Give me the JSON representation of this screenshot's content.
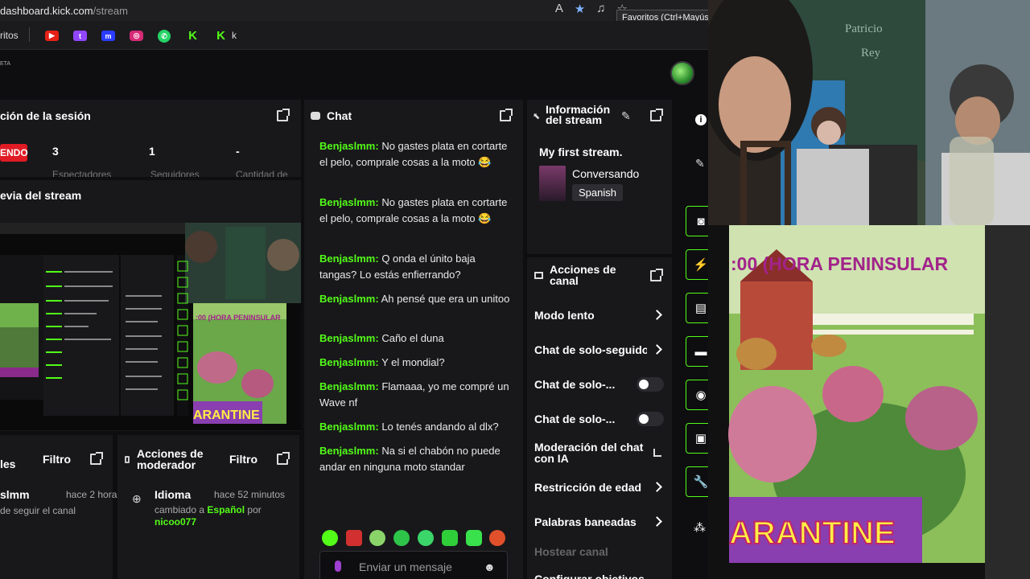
{
  "browser": {
    "url_host": "dashboard.kick.com",
    "url_path": "/stream",
    "tooltip": "Favoritos (Ctrl+Mayús",
    "bookmarks_folder": "ritos",
    "bookmark_last": "k"
  },
  "session": {
    "title": "ción de la sesión",
    "live_label": "ENDO",
    "stats": [
      {
        "value": "3",
        "label": "Espectadores"
      },
      {
        "value": "1",
        "label": "Seguidores"
      },
      {
        "value": "-",
        "label": "Cantidad de"
      }
    ]
  },
  "preview": {
    "title": "evia del stream"
  },
  "chat": {
    "title": "Chat",
    "messages": [
      {
        "user": "Benjaslmm:",
        "text": "No gastes plata en cortarte el pelo, comprale cosas a la moto 😂"
      },
      {
        "user": "Benjaslmm:",
        "text": "No gastes plata en cortarte el pelo, comprale cosas a la moto 😂"
      },
      {
        "user": "Benjaslmm:",
        "text": "Q onda el únito baja tangas? Lo estás enfierrando?"
      },
      {
        "user": "Benjaslmm:",
        "text": "Ah pensé que era un unitoo"
      },
      {
        "user": "Benjaslmm:",
        "text": "Caño el duna"
      },
      {
        "user": "Benjaslmm:",
        "text": "Y el mondial?"
      },
      {
        "user": "Benjaslmm:",
        "text": "Flamaaa, yo me compré un Wave nf"
      },
      {
        "user": "Benjaslmm:",
        "text": "Lo tenés andando al dlx?"
      },
      {
        "user": "Benjaslmm:",
        "text": "Na si el chabón no puede andar en ninguna moto standar"
      }
    ],
    "input_placeholder": "Enviar un mensaje"
  },
  "stream_info": {
    "title": "Información del stream",
    "stream_title": "My first stream.",
    "category": "Conversando",
    "language": "Spanish"
  },
  "channel_actions": {
    "title": "Acciones de canal",
    "items": [
      {
        "label": "Modo lento",
        "control": "chevron"
      },
      {
        "label": "Chat de solo-seguido",
        "control": "chevron"
      },
      {
        "label": "Chat de solo-...",
        "control": "toggle"
      },
      {
        "label": "Chat de solo-...",
        "control": "toggle"
      },
      {
        "label": "Moderación del chat con IA",
        "control": "external"
      },
      {
        "label": "Restricción de edad",
        "control": "chevron"
      },
      {
        "label": "Palabras baneadas",
        "control": "chevron"
      },
      {
        "label": "Hostear canal",
        "control": "none"
      },
      {
        "label": "Configurar objetivos",
        "control": "chevron"
      }
    ]
  },
  "activity": {
    "title": "les",
    "filter": "Filtro",
    "user": "slmm",
    "time": "hace 2 horas",
    "text": "de seguir el canal"
  },
  "mod_actions": {
    "title": "Acciones de moderador",
    "filter": "Filtro",
    "entry_title": "Idioma",
    "entry_time": "hace 52 minutos",
    "entry_prefix": "cambiado a",
    "entry_value": "Español",
    "entry_by": "por",
    "entry_user": "nicoo077"
  },
  "overlay": {
    "banner_text": ":00 (HORA PENINSULAR",
    "bottom_text": "ARANTINE"
  },
  "cam": {
    "board_text": "Patricio Rey"
  },
  "colors": {
    "accent": "#53fc18",
    "live": "#e01b24",
    "panel": "#18181b",
    "background": "#0e0e10"
  }
}
